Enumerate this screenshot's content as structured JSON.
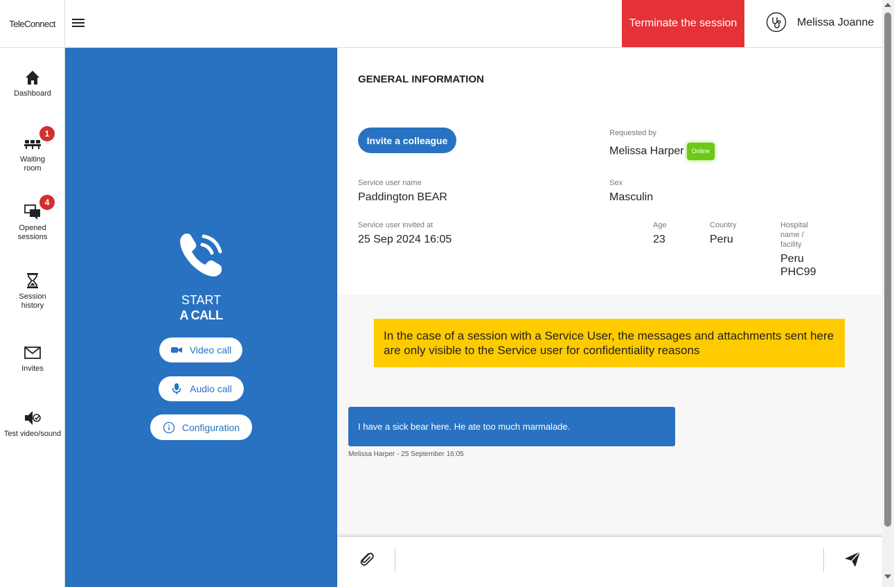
{
  "app": {
    "logo": "TeleConnect"
  },
  "header": {
    "terminate_label": "Terminate the session",
    "user_name": "Melissa Joanne"
  },
  "colors": {
    "brand_blue": "#2872c1",
    "terminate_red": "#e53238",
    "notice_yellow": "#fecb00",
    "online_green": "#6cc91a",
    "badge_red": "#d32f2f"
  },
  "sidebar": {
    "items": [
      {
        "label": "Dashboard",
        "icon": "home-icon"
      },
      {
        "label": "Waiting room",
        "icon": "waiting-room-icon",
        "badge": "1"
      },
      {
        "label": "Opened sessions",
        "icon": "chat-bubbles-icon",
        "badge": "4"
      },
      {
        "label": "Session history",
        "icon": "hourglass-icon"
      },
      {
        "label": "Invites",
        "icon": "envelope-icon"
      },
      {
        "label": "Test video/sound",
        "icon": "speaker-check-icon"
      }
    ]
  },
  "call": {
    "start": "START",
    "a_call": "A CALL",
    "video_label": "Video call",
    "audio_label": "Audio call",
    "config_label": "Configuration"
  },
  "general": {
    "title": "GENERAL INFORMATION",
    "invite_label": "Invite a colleague",
    "requested_by_label": "Requested by",
    "requested_by_value": "Melissa Harper",
    "online_label": "Online",
    "service_user_name_label": "Service user name",
    "service_user_name_value": "Paddington BEAR",
    "sex_label": "Sex",
    "sex_value": "Masculin",
    "invited_at_label": "Service user invited at",
    "invited_at_value": "25 Sep 2024 16:05",
    "age_label": "Age",
    "age_value": "23",
    "country_label": "Country",
    "country_value": "Peru",
    "hospital_label_1": "Hospital",
    "hospital_label_2": "name /",
    "hospital_label_3": "facility",
    "hospital_value_1": "Peru",
    "hospital_value_2": "PHC99"
  },
  "chat": {
    "notice": "In the case of a session with a Service User, the messages and attachments sent here are only visible to the Service user for confidentiality reasons",
    "messages": [
      {
        "text": "I have a sick bear here. He ate too much marmalade.",
        "meta": "Melissa Harper - 25 September 16:05"
      }
    ],
    "input_placeholder": ""
  }
}
